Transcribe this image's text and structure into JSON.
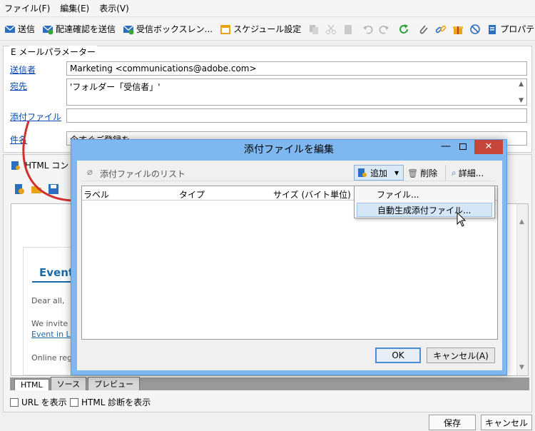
{
  "menu": [
    "ファイル(F)",
    "編集(E)",
    "表示(V)"
  ],
  "toolbar": {
    "send": "送信",
    "send_proof": "配達確認を送信",
    "inbox": "受信ボックスレン...",
    "schedule": "スケジュール設定",
    "properties": "プロパティ"
  },
  "params": {
    "legend": "E メールパラメーター",
    "from_label": "送信者",
    "from_value": "Marketing <communications@adobe.com>",
    "to_label": "宛先",
    "to_value": "'フォルダー「受信者」'",
    "attach_label": "添付ファイル",
    "attach_value": "",
    "subject_label": "件名",
    "subject_value": "今すぐご登録を"
  },
  "editor": {
    "tab_label": "HTML コン",
    "heading": "Event",
    "greeting": "Dear all,",
    "invite": "We invite",
    "link": "Event in Lo",
    "online": "Online reg",
    "bottom_tabs": [
      "HTML",
      "ソース",
      "プレビュー"
    ],
    "show_url": "URL を表示",
    "show_diag": "HTML 診断を表示"
  },
  "footer": {
    "save": "保存",
    "cancel": "キャンセル"
  },
  "dialog": {
    "title": "添付ファイルを編集",
    "list_label": "添付ファイルのリスト",
    "add": "追加",
    "delete": "削除",
    "detail": "詳細...",
    "columns": [
      "ラベル",
      "タイプ",
      "サイズ (バイト単位)"
    ],
    "ok": "OK",
    "cancel": "キャンセル(A)",
    "menu": [
      "ファイル...",
      "自動生成添付ファイル..."
    ]
  }
}
